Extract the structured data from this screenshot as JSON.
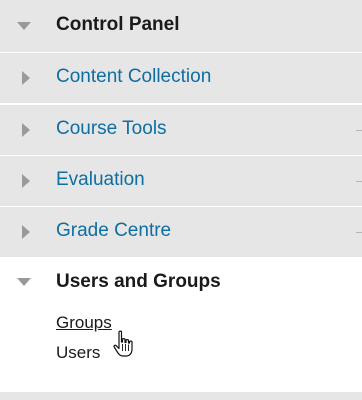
{
  "control_panel": {
    "title": "Control Panel",
    "items": [
      {
        "label": "Content Collection"
      },
      {
        "label": "Course Tools"
      },
      {
        "label": "Evaluation"
      },
      {
        "label": "Grade Centre"
      }
    ]
  },
  "users_and_groups": {
    "title": "Users and Groups",
    "links": [
      {
        "label": "Groups"
      },
      {
        "label": "Users"
      }
    ]
  },
  "colors": {
    "panel_bg": "#e6e6e6",
    "link_blue": "#0e6ea1",
    "text_dark": "#1a1a1a"
  },
  "icons": {
    "expanded": "chevron-down-icon",
    "collapsed": "chevron-right-icon",
    "pointer": "hand-pointer-cursor-icon"
  }
}
